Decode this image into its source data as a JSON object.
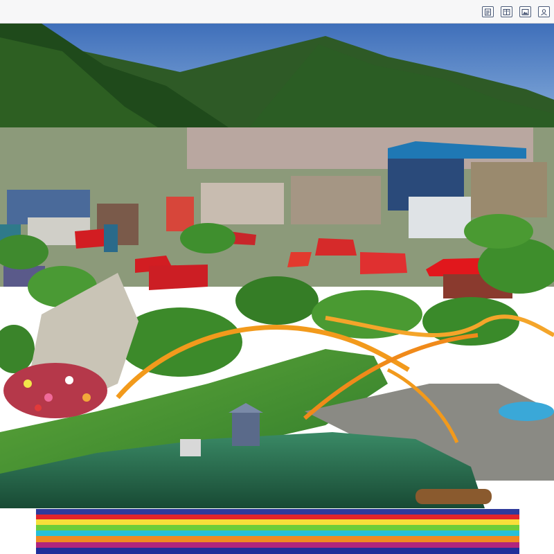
{
  "header": {
    "title": "",
    "toolbar": [
      {
        "icon": "document-icon"
      },
      {
        "icon": "book-icon"
      },
      {
        "icon": "gallery-icon"
      },
      {
        "icon": "profile-icon"
      }
    ]
  },
  "photo": {
    "subject": "hillside-village-with-park-and-lake"
  },
  "colors": {
    "sky": "#4f7fc4",
    "forest": "#244d1e",
    "roof_red": "#d21d22",
    "track_orange": "#f29a1c",
    "lake": "#2c6e50",
    "strip_bands": [
      "#2e3a9c",
      "#e2242a",
      "#f7df3a",
      "#6dcd3a",
      "#27c0d8",
      "#f08a22",
      "#b0257d",
      "#1f2f9a"
    ]
  }
}
